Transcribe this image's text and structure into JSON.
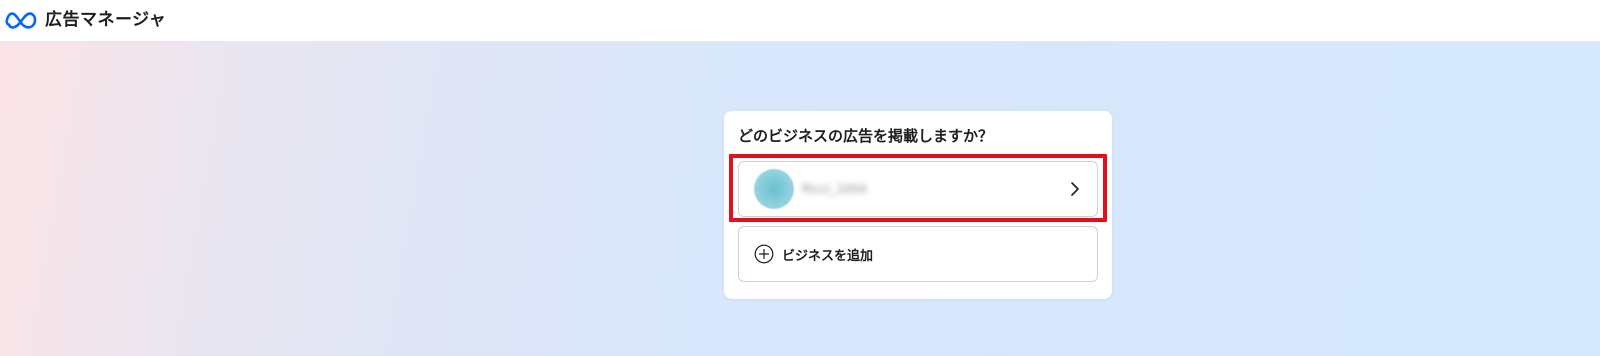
{
  "app": {
    "title": "広告マネージャ"
  },
  "dialog": {
    "title": "どのビジネスの広告を掲載しますか？",
    "businesses": [
      {
        "name": "Ricci_1004"
      }
    ],
    "add_business_label": "ビジネスを追加"
  },
  "icons": {
    "logo": "meta-logo-icon",
    "avatar": "business-avatar",
    "chevron": "chevron-right-icon",
    "add": "plus-circle-icon"
  },
  "colors": {
    "highlight": "#e3101c",
    "meta_blue": "#0866ff",
    "avatar": "#7cc7d6"
  }
}
